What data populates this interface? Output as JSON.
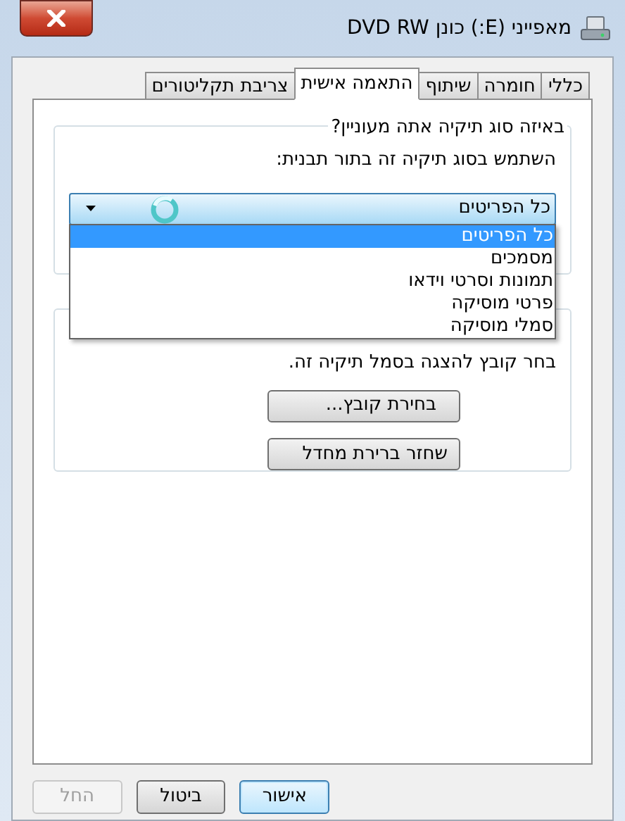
{
  "window": {
    "title": "מאפייני (E:) כונן DVD RW"
  },
  "tabs": [
    {
      "label": "כללי",
      "selected": false
    },
    {
      "label": "חומרה",
      "selected": false
    },
    {
      "label": "שיתוף",
      "selected": false
    },
    {
      "label": "התאמה אישית",
      "selected": true
    },
    {
      "label": "צריבת תקליטורים",
      "selected": false
    }
  ],
  "folder_type_group": {
    "title": "באיזה סוג תיקיה אתה מעוניין?",
    "label": "השתמש בסוג תיקיה זה בתור תבנית:",
    "dropdown": {
      "value": "כל הפריטים",
      "expanded": true,
      "options": [
        {
          "label": "כל הפריטים",
          "selected": true
        },
        {
          "label": "מסמכים",
          "selected": false
        },
        {
          "label": "תמונות וסרטי וידאו",
          "selected": false
        },
        {
          "label": "פרטי מוסיקה",
          "selected": false
        },
        {
          "label": "סמלי מוסיקה",
          "selected": false
        }
      ]
    }
  },
  "folder_icon_group": {
    "text": "בחר קובץ להצגה בסמל תיקיה זה.",
    "buttons": [
      "בחירת קובץ...",
      "שחזר ברירת מחדל"
    ]
  },
  "buttons": [
    {
      "label": "אישור",
      "default": true,
      "disabled": false
    },
    {
      "label": "ביטול",
      "default": false,
      "disabled": false
    },
    {
      "label": "החל",
      "default": false,
      "disabled": true
    }
  ]
}
